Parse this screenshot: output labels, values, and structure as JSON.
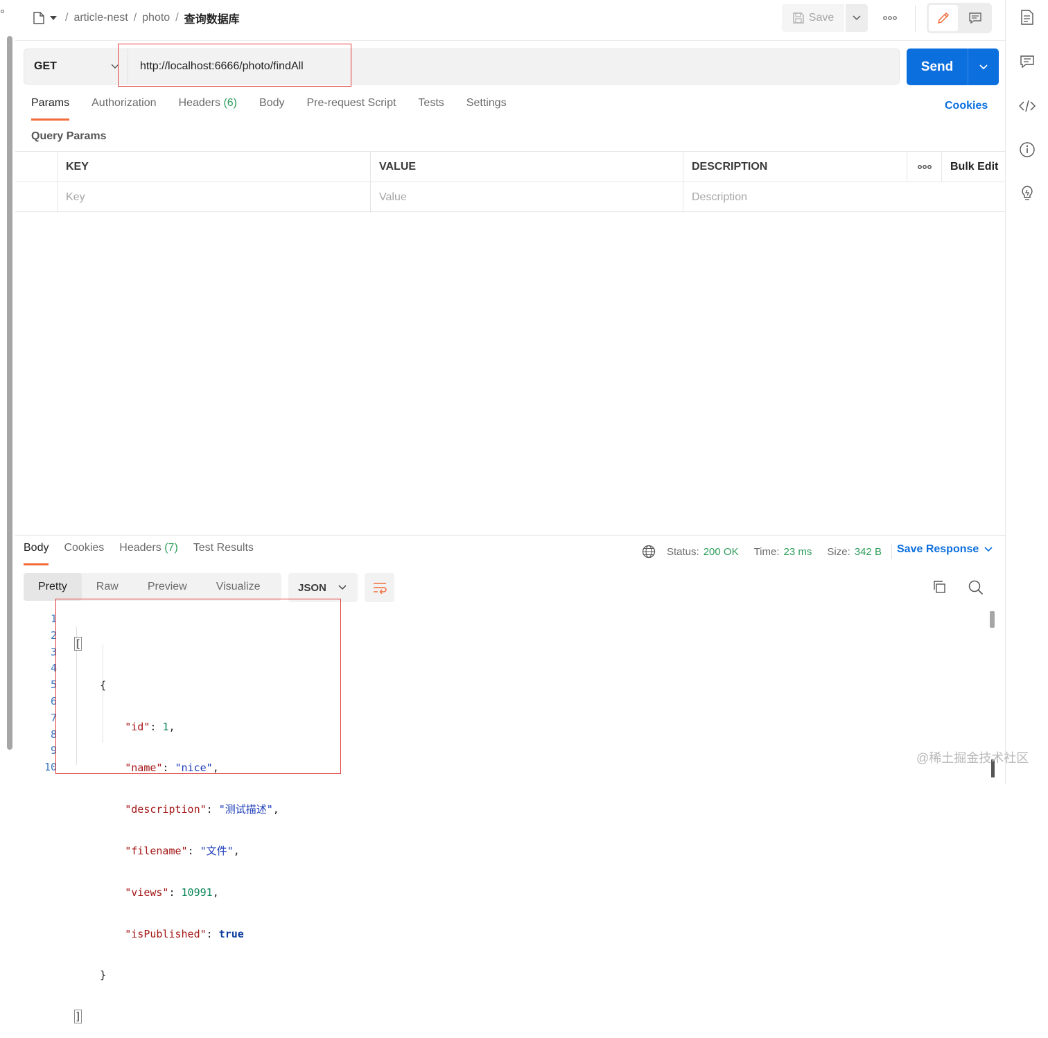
{
  "breadcrumb": {
    "parts": [
      "article-nest",
      "photo"
    ],
    "current": "查询数据库",
    "sep": "/"
  },
  "toolbar": {
    "save_label": "Save"
  },
  "request": {
    "method": "GET",
    "url": "http://localhost:6666/photo/findAll",
    "send_label": "Send"
  },
  "req_tabs": [
    {
      "label": "Params",
      "active": true
    },
    {
      "label": "Authorization"
    },
    {
      "label": "Headers",
      "count": "(6)"
    },
    {
      "label": "Body"
    },
    {
      "label": "Pre-request Script"
    },
    {
      "label": "Tests"
    },
    {
      "label": "Settings"
    }
  ],
  "cookies_label": "Cookies",
  "query_params": {
    "title": "Query Params",
    "headers": {
      "key": "KEY",
      "value": "VALUE",
      "description": "DESCRIPTION",
      "bulk_edit": "Bulk Edit"
    },
    "placeholders": {
      "key": "Key",
      "value": "Value",
      "description": "Description"
    }
  },
  "response": {
    "tabs": [
      {
        "label": "Body",
        "active": true
      },
      {
        "label": "Cookies"
      },
      {
        "label": "Headers",
        "count": "(7)"
      },
      {
        "label": "Test Results"
      }
    ],
    "status_label": "Status:",
    "status_value": "200 OK",
    "time_label": "Time:",
    "time_value": "23 ms",
    "size_label": "Size:",
    "size_value": "342 B",
    "save_response": "Save Response",
    "view_tabs": [
      "Pretty",
      "Raw",
      "Preview",
      "Visualize"
    ],
    "format": "JSON",
    "line_numbers": [
      "1",
      "2",
      "3",
      "4",
      "5",
      "6",
      "7",
      "8",
      "9",
      "10"
    ],
    "json": {
      "open_arr": "[",
      "open_obj": "{",
      "fields": [
        {
          "key": "\"id\"",
          "value": "1",
          "type": "n",
          "comma": ","
        },
        {
          "key": "\"name\"",
          "value": "\"nice\"",
          "type": "s",
          "comma": ","
        },
        {
          "key": "\"description\"",
          "value": "\"测试描述\"",
          "type": "s",
          "comma": ","
        },
        {
          "key": "\"filename\"",
          "value": "\"文件\"",
          "type": "s",
          "comma": ","
        },
        {
          "key": "\"views\"",
          "value": "10991",
          "type": "n",
          "comma": ","
        },
        {
          "key": "\"isPublished\"",
          "value": "true",
          "type": "b",
          "comma": ""
        }
      ],
      "close_obj": "}",
      "close_arr": "]"
    }
  },
  "watermark": "@稀土掘金技术社区",
  "colors": {
    "accent_blue": "#0b6fde",
    "tab_underline": "#f26b3a",
    "status_green": "#2d9d5a",
    "highlight_red": "#e03a3a"
  },
  "icons": [
    "collection-icon",
    "save-icon",
    "chevron-down-icon",
    "more-icon",
    "edit-icon",
    "comment-icon",
    "documentation-icon",
    "code-icon",
    "info-icon",
    "lightbulb-icon",
    "globe-icon",
    "wrap-icon",
    "copy-icon",
    "search-icon"
  ]
}
